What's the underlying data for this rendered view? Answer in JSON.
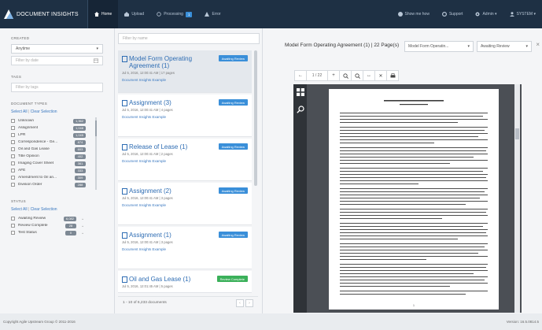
{
  "app": {
    "name": "DOCUMENT INSIGHTS"
  },
  "nav": {
    "items": [
      {
        "label": "Home",
        "icon": "home-icon"
      },
      {
        "label": "Upload",
        "icon": "upload-icon"
      },
      {
        "label": "Processing",
        "icon": "refresh-icon",
        "count": "1"
      },
      {
        "label": "Error",
        "icon": "warning-icon"
      }
    ],
    "right": [
      {
        "label": "Show me how",
        "icon": "info-icon"
      },
      {
        "label": "Support",
        "icon": "lifebuoy-icon"
      },
      {
        "label": "Admin ▾",
        "icon": "gear-icon"
      },
      {
        "label": "SYSTEM ▾",
        "icon": "user-icon"
      }
    ]
  },
  "filters": {
    "created_heading": "CREATED",
    "created_value": "Anytime",
    "date_placeholder": "Filter by date",
    "tags_heading": "TAGS",
    "tags_placeholder": "Filter by tags",
    "doctypes_heading": "DOCUMENT TYPES",
    "select_all": "Select All",
    "clear_selection": "Clear Selection",
    "doctypes": [
      {
        "label": "Unknown",
        "count": "1,362"
      },
      {
        "label": "Assignment",
        "count": "1,048"
      },
      {
        "label": "LPR",
        "count": "1,045"
      },
      {
        "label": "Correspondence - Ge...",
        "count": "874"
      },
      {
        "label": "Oil and Gas Lease",
        "count": "603"
      },
      {
        "label": "Title Opinion",
        "count": "402"
      },
      {
        "label": "Imaging Cover Sheet",
        "count": "361"
      },
      {
        "label": "AFE",
        "count": "333"
      },
      {
        "label": "Amendment to Oil an...",
        "count": "309"
      },
      {
        "label": "Division Order",
        "count": "288"
      }
    ],
    "status_heading": "STATUS",
    "statuses": [
      {
        "label": "Awaiting Review",
        "count": "6,082"
      },
      {
        "label": "Review Complete",
        "count": "28"
      },
      {
        "label": "Test Status",
        "count": "0"
      }
    ]
  },
  "results": {
    "search_placeholder": "Filter by name",
    "items": [
      {
        "title": "Model Form Operating Agreement (1)",
        "meta": "Jul 5, 2016, 12:00:41 AM | 17 pages",
        "client": "Document Insights Example",
        "status": "Awaiting Review",
        "status_color": "#3a8fd9"
      },
      {
        "title": "Assignment (3)",
        "meta": "Jul 5, 2016, 12:00:41 AM | 4 pages",
        "client": "Document Insights Example",
        "status": "Awaiting Review",
        "status_color": "#3a8fd9"
      },
      {
        "title": "Release of Lease (1)",
        "meta": "Jul 5, 2016, 12:00:41 AM | 2 pages",
        "client": "Document Insights Example",
        "status": "Awaiting Review",
        "status_color": "#3a8fd9"
      },
      {
        "title": "Assignment (2)",
        "meta": "Jul 5, 2016, 12:00:41 AM | 3 pages",
        "client": "Document Insights Example",
        "status": "Awaiting Review",
        "status_color": "#3a8fd9"
      },
      {
        "title": "Assignment (1)",
        "meta": "Jul 5, 2016, 12:00:41 AM | 3 pages",
        "client": "Document Insights Example",
        "status": "Awaiting Review",
        "status_color": "#3a8fd9"
      },
      {
        "title": "Oil and Gas Lease (1)",
        "meta": "Jul 5, 2016, 12:01:45 AM | 5 pages",
        "client": "",
        "status": "Review Complete",
        "status_color": "#3bb05a"
      }
    ],
    "pager_text": "1 - 10 of 6,233 documents",
    "prev": "‹",
    "next": "›"
  },
  "viewer": {
    "title": "Model Form Operating Agreement (1) | 22 Page(s)",
    "type_select": "Model Form Operatin...",
    "status_select": "Awaiting Review",
    "close": "×",
    "page_indicator": "1 / 22",
    "tools": [
      "←",
      "+",
      "−",
      "🔍",
      "🔍",
      "↔",
      "✕",
      "🖨"
    ],
    "page_number": "1"
  },
  "footer": {
    "copyright": "Copyright Agile Upstream Group © 2011-2016",
    "version": "Version: 16.5.0814.5"
  },
  "colors": {
    "nav_bg": "#1e3044",
    "accent": "#3a8fd9",
    "success": "#3bb05a",
    "link": "#2d6cb3"
  }
}
